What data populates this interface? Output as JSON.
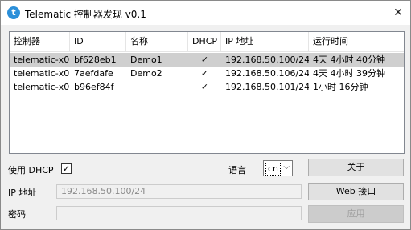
{
  "window": {
    "title": "Telematic 控制器发现 v0.1",
    "icon_letter": "t",
    "close_glyph": "✕"
  },
  "table": {
    "columns": [
      "控制器",
      "ID",
      "名称",
      "DHCP",
      "IP 地址",
      "运行时间"
    ],
    "rows": [
      {
        "controller": "telematic-x0",
        "id": "bf628eb1",
        "name": "Demo1",
        "dhcp": "✓",
        "ip": "192.168.50.100/24",
        "uptime": "4天 4小时 40分钟",
        "selected": true
      },
      {
        "controller": "telematic-x0",
        "id": "7aefdafe",
        "name": "Demo2",
        "dhcp": "✓",
        "ip": "192.168.50.106/24",
        "uptime": "4天 4小时 39分钟",
        "selected": false
      },
      {
        "controller": "telematic-x0",
        "id": "b96ef84f",
        "name": "",
        "dhcp": "✓",
        "ip": "192.168.50.101/24",
        "uptime": "1小时 16分钟",
        "selected": false
      }
    ]
  },
  "form": {
    "dhcp_label": "使用 DHCP",
    "dhcp_checked": "✓",
    "language_label": "语言",
    "language_value": "cn",
    "language_chevron": "⌵",
    "ip_label": "IP 地址",
    "ip_value": "192.168.50.100/24",
    "password_label": "密码",
    "password_value": ""
  },
  "buttons": {
    "about": "关于",
    "web": "Web 接口",
    "apply": "应用"
  }
}
